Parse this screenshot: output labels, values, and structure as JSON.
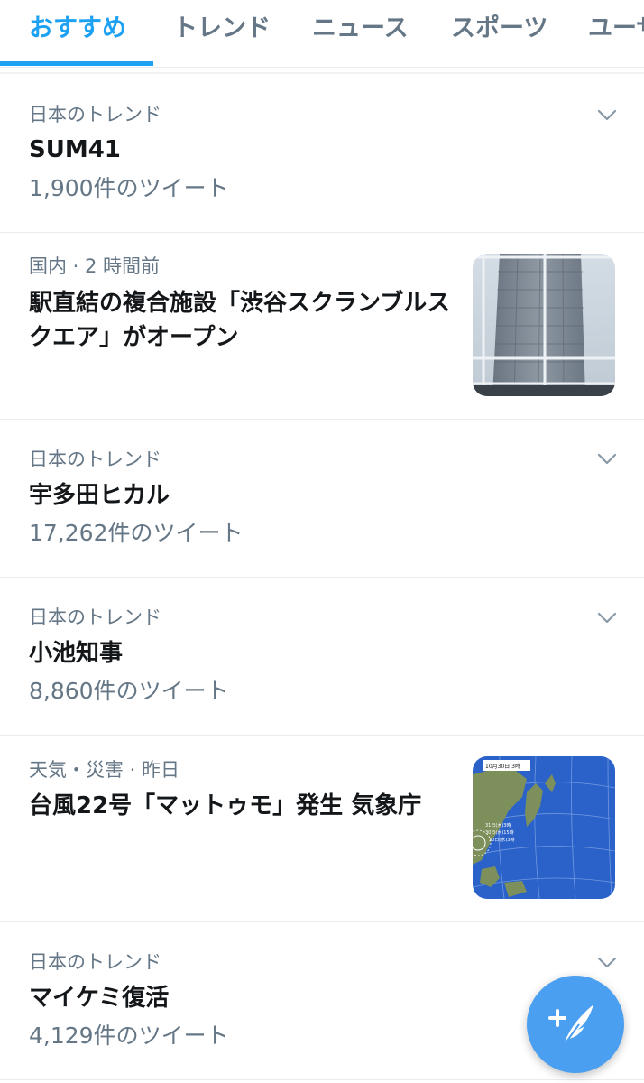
{
  "tabs": [
    {
      "label": "おすすめ",
      "active": true
    },
    {
      "label": "トレンド",
      "active": false
    },
    {
      "label": "ニュース",
      "active": false
    },
    {
      "label": "スポーツ",
      "active": false
    },
    {
      "label": "ユーザ",
      "active": false
    }
  ],
  "feed": [
    {
      "type": "trend",
      "meta": "日本のトレンド",
      "title": "SUM41",
      "count": "1,900件のツイート"
    },
    {
      "type": "news",
      "meta": "国内 · 2 時間前",
      "title": "駅直結の複合施設「渋谷スクランブルスクエア」がオープン",
      "thumbnail": "building-photo"
    },
    {
      "type": "trend",
      "meta": "日本のトレンド",
      "title": "宇多田ヒカル",
      "count": "17,262件のツイート"
    },
    {
      "type": "trend",
      "meta": "日本のトレンド",
      "title": "小池知事",
      "count": "8,860件のツイート"
    },
    {
      "type": "news",
      "meta": "天気・災害 · 昨日",
      "title": "台風22号「マットゥモ」発生 気象庁",
      "thumbnail": "weather-map",
      "map_labels": {
        "header": "10月30日 3時",
        "line1": "31日(木)3時",
        "line2": "30日(水)15時",
        "line3": "30日(水)3時"
      }
    },
    {
      "type": "trend",
      "meta": "日本のトレンド",
      "title": "マイケミ復活",
      "count": "4,129件のツイート"
    }
  ],
  "fab": {
    "icon": "compose-tweet-icon"
  },
  "colors": {
    "accent": "#1da1f2",
    "secondary_text": "#657786",
    "primary_text": "#14171a",
    "divider": "#e6ecf0",
    "fab": "#4a9ff0"
  }
}
